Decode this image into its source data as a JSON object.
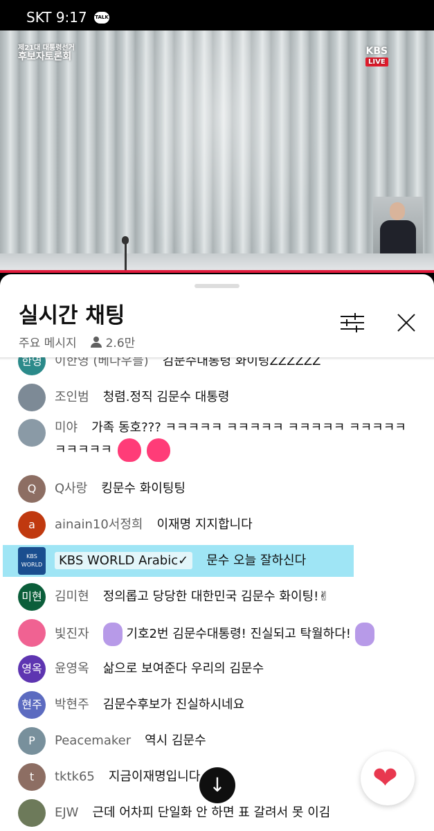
{
  "status_bar": {
    "carrier_time": "SKT 9:17",
    "talk_badge": "TALK"
  },
  "video": {
    "program_line1": "제21대 대통령선거",
    "program_line2": "후보자토론회",
    "channel": "KBS",
    "live_label": "LIVE"
  },
  "chat_header": {
    "title": "실시간 채팅",
    "mode": "주요 메시지",
    "viewer_count": "2.6만"
  },
  "messages": [
    {
      "author": "이한영 (베다우블)",
      "avatar_text": "한영",
      "avatar_color": "#2b8a8a",
      "text": "김문수대통령 화이팅ZZZZZZ"
    },
    {
      "author": "조인범",
      "avatar_text": "",
      "avatar_color": "#7d8a96",
      "text": "청렴.정직 김문수 대통령"
    },
    {
      "author": "미야",
      "avatar_text": "",
      "avatar_color": "#8a9aa6",
      "text": "가족 동호??? ㅋㅋㅋㅋㅋ ㅋㅋㅋㅋㅋ ㅋㅋㅋㅋㅋ ㅋㅋㅋㅋㅋ ㅋㅋㅋㅋㅋ"
    },
    {
      "author": "Q사랑",
      "avatar_text": "Q",
      "avatar_color": "#8d6e63",
      "text": "킹문수 화이팅팅"
    },
    {
      "author": "ainain10서정희",
      "avatar_text": "a",
      "avatar_color": "#c0390f",
      "text": "이재명 지지합니다"
    },
    {
      "author": "KBS WORLD Arabic",
      "verified": "✓",
      "avatar_text": "KBS WORLD",
      "avatar_color": "#1a4e8f",
      "text": "문수 오늘 잘하신다"
    },
    {
      "author": "김미현",
      "avatar_text": "미현",
      "avatar_color": "#0b5e3a",
      "text": "정의롭고 당당한 대한민국 김문수 화이팅!✌"
    },
    {
      "author": "빛진자",
      "avatar_text": "",
      "avatar_color": "#f06292",
      "text": "기호2번 김문수대통령! 진실되고 탁월하다!"
    },
    {
      "author": "윤영옥",
      "avatar_text": "영옥",
      "avatar_color": "#5e35b1",
      "text": "삶으로 보여준다 우리의 김문수"
    },
    {
      "author": "박현주",
      "avatar_text": "현주",
      "avatar_color": "#5c6bc0",
      "text": "김문수후보가 진실하시네요"
    },
    {
      "author": "Peacemaker",
      "avatar_text": "P",
      "avatar_color": "#78909c",
      "text": "역시 김문수"
    },
    {
      "author": "tktk65",
      "avatar_text": "t",
      "avatar_color": "#8d6e63",
      "text": "지금이재명입니다"
    },
    {
      "author": "EJW",
      "avatar_text": "",
      "avatar_color": "#6d7a5a",
      "text": "근데 어차피 단일화 안 하면 표 갈려서 못 이김"
    }
  ],
  "buttons": {
    "scroll_down_icon": "↓",
    "heart_icon": "❤"
  }
}
